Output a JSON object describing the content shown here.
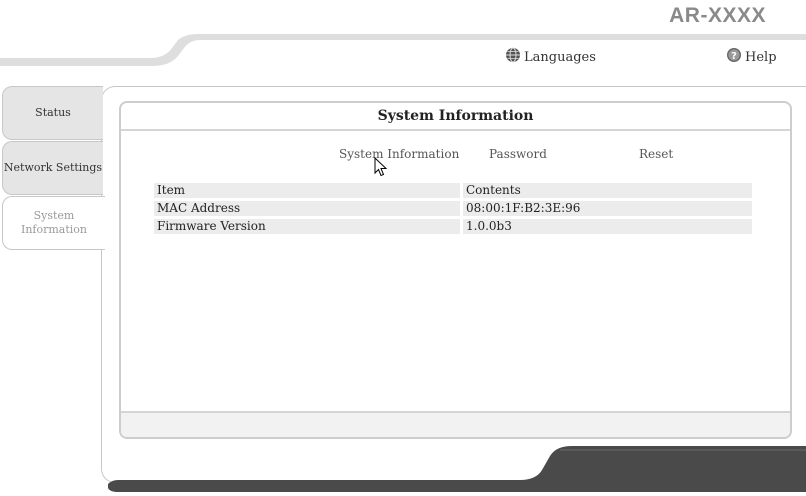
{
  "header": {
    "model": "AR-XXXX",
    "languages_label": "Languages",
    "help_label": "Help"
  },
  "tabs": [
    {
      "label": "Status",
      "active": false
    },
    {
      "label": "Network Settings",
      "active": false
    },
    {
      "label": "System Information",
      "active": true
    }
  ],
  "panel": {
    "title": "System Information",
    "subnav": [
      "System Information",
      "Password",
      "Reset"
    ]
  },
  "table": {
    "headers": [
      "Item",
      "Contents"
    ],
    "rows": [
      [
        "MAC Address",
        "08:00:1F:B2:3E:96"
      ],
      [
        "Firmware Version",
        "1.0.0b3"
      ]
    ]
  },
  "colors": {
    "header_bar": "#dedede",
    "footer_bar": "#4a4a4a",
    "tab_inactive": "#e5e5e5",
    "row_bg": "#ececec"
  },
  "icons": {
    "languages": "globe-icon",
    "help": "question-circle-icon",
    "cursor": "mouse-pointer-icon"
  }
}
